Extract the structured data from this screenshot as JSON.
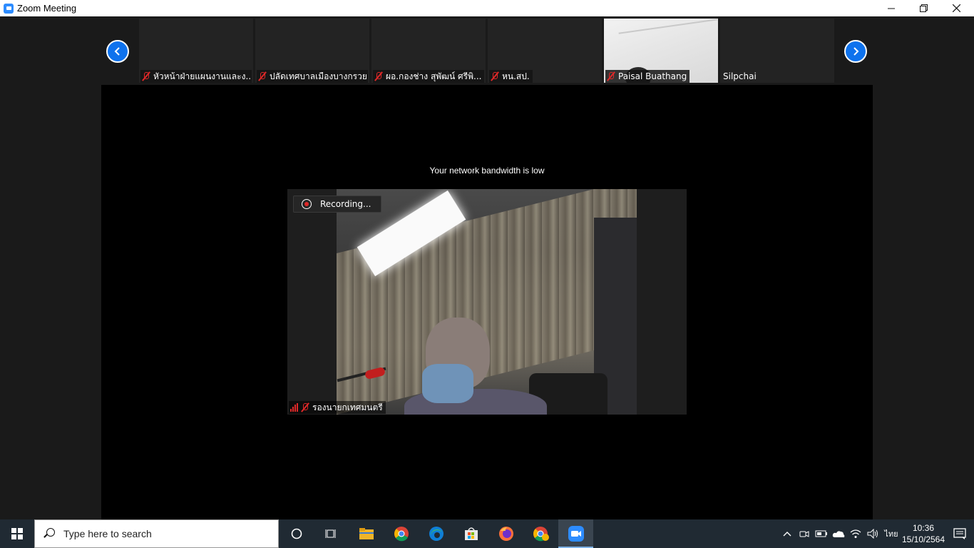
{
  "window": {
    "title": "Zoom Meeting"
  },
  "participants": [
    {
      "name": "หัวหน้าฝ่ายแผนงานและง...",
      "muted": true
    },
    {
      "name": "ปลัดเทศบาลเมืองบางกรวย",
      "muted": true
    },
    {
      "name": "ผอ.กองช่าง สุพัฒน์ ศรีพิ...",
      "muted": true
    },
    {
      "name": "หน.สป.",
      "muted": true
    },
    {
      "name": "Paisal Buathang",
      "muted": true
    },
    {
      "name": "Silpchai",
      "muted": false
    }
  ],
  "main_video": {
    "notice": "Your network bandwidth is low",
    "recording_label": "Recording...",
    "speaker_name": "รองนายกเทศมนตรี"
  },
  "taskbar": {
    "search_placeholder": "Type here to search",
    "language": "ไทย",
    "time": "10:36",
    "date": "15/10/2564"
  },
  "colors": {
    "accent": "#0e72ed",
    "muted_red": "#e02828",
    "taskbar": "#202a33"
  }
}
